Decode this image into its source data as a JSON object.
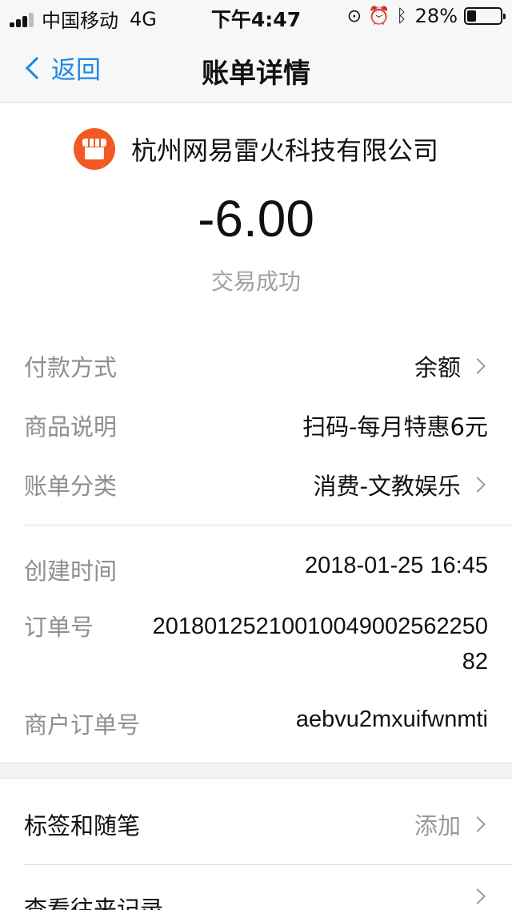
{
  "status_bar": {
    "carrier": "中国移动",
    "network": "4G",
    "time": "下午4:47",
    "battery_percent": "28%",
    "battery_level": 0.28
  },
  "nav": {
    "back_label": "返回",
    "title": "账单详情"
  },
  "merchant": {
    "name": "杭州网易雷火科技有限公司",
    "amount": "-6.00",
    "status": "交易成功",
    "logo_color": "#f15a22"
  },
  "details": {
    "payment_method": {
      "label": "付款方式",
      "value": "余额"
    },
    "product_desc": {
      "label": "商品说明",
      "value": "扫码-每月特惠6元"
    },
    "category": {
      "label": "账单分类",
      "value": "消费-文教娱乐"
    },
    "created_time": {
      "label": "创建时间",
      "value": "2018-01-25 16:45"
    },
    "order_no": {
      "label": "订单号",
      "value": "2018012521001004900256225082"
    },
    "merchant_order_no": {
      "label": "商户订单号",
      "value": "aebvu2mxuifwnmti"
    }
  },
  "extras": {
    "tags": {
      "label": "标签和随笔",
      "action": "添加"
    },
    "history": {
      "label": "查看往来记录"
    }
  },
  "colors": {
    "accent": "#1e88e5"
  }
}
